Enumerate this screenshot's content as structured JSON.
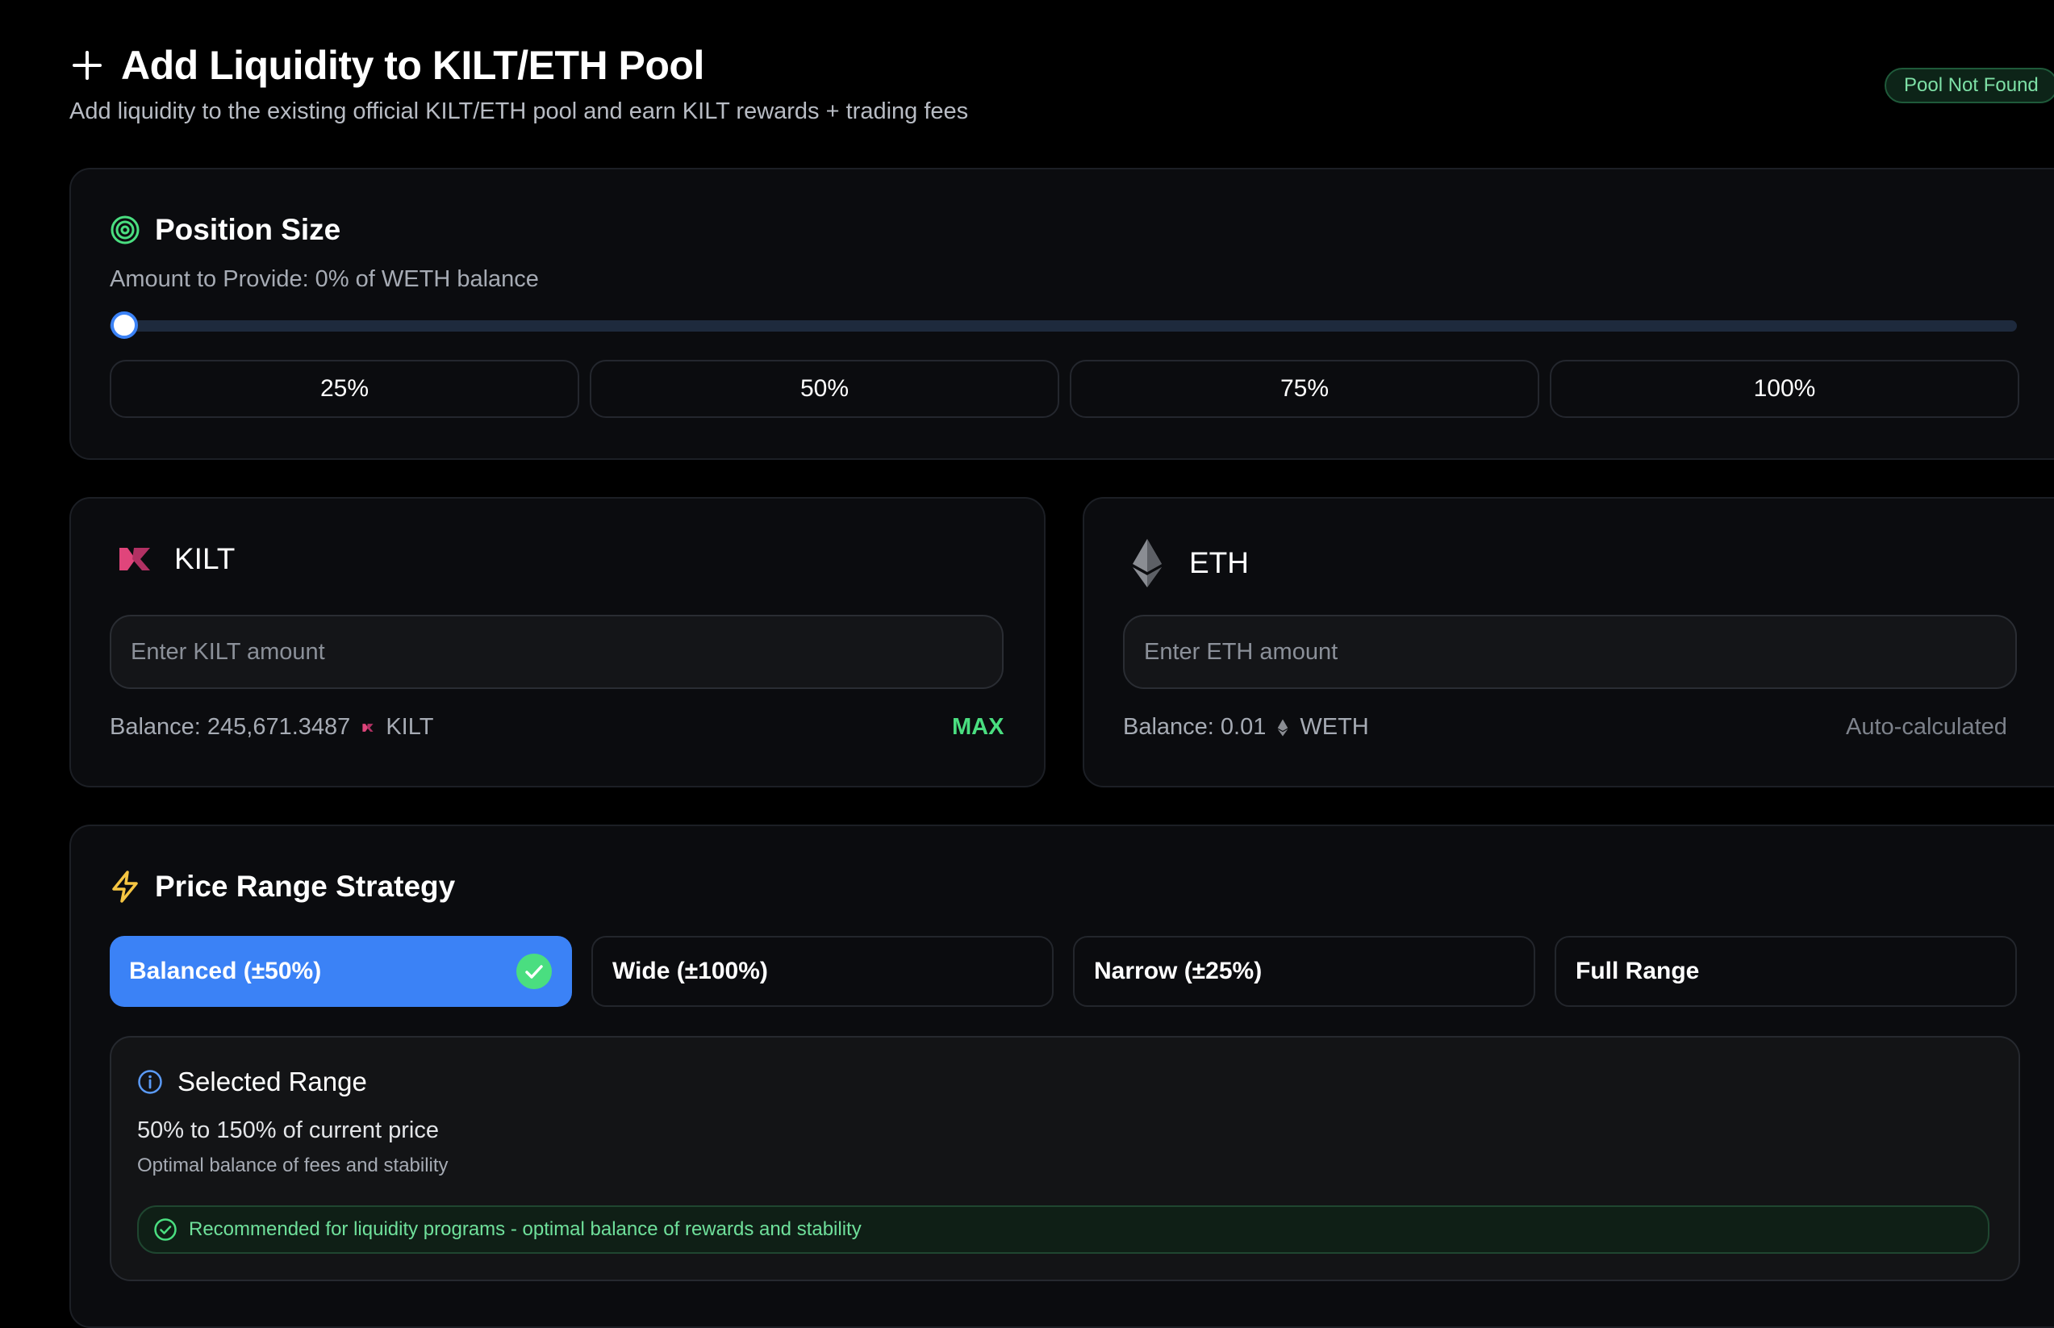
{
  "header": {
    "title": "Add Liquidity to KILT/ETH Pool",
    "subtitle": "Add liquidity to the existing official KILT/ETH pool and earn KILT rewards + trading fees",
    "status_badge": "Pool Not Found",
    "plus_icon": "plus-icon"
  },
  "position_size": {
    "title": "Position Size",
    "amount_label": "Amount to Provide: 0% of WETH balance",
    "slider_value": 0,
    "presets": [
      "25%",
      "50%",
      "75%",
      "100%"
    ]
  },
  "kilt": {
    "token": "KILT",
    "placeholder": "Enter KILT amount",
    "balance_label": "Balance: 245,671.3487",
    "balance_symbol": "KILT",
    "max_label": "MAX"
  },
  "eth": {
    "token": "ETH",
    "placeholder": "Enter ETH amount",
    "balance_label": "Balance: 0.01",
    "balance_symbol": "WETH",
    "note": "Auto-calculated"
  },
  "strategy": {
    "title": "Price Range Strategy",
    "options": [
      "Balanced (±50%)",
      "Wide (±100%)",
      "Narrow (±25%)",
      "Full Range"
    ],
    "selected": "Balanced (±50%)"
  },
  "selected_range": {
    "title": "Selected Range",
    "range": "50% to 150% of current price",
    "description": "Optimal balance of fees and stability",
    "recommendation": "Recommended for liquidity programs - optimal balance of rewards and stability"
  },
  "colors": {
    "accent": "#3b82f6",
    "success": "#4ade80",
    "kilt_pink": "#e0457b",
    "warning": "#f5c542"
  }
}
